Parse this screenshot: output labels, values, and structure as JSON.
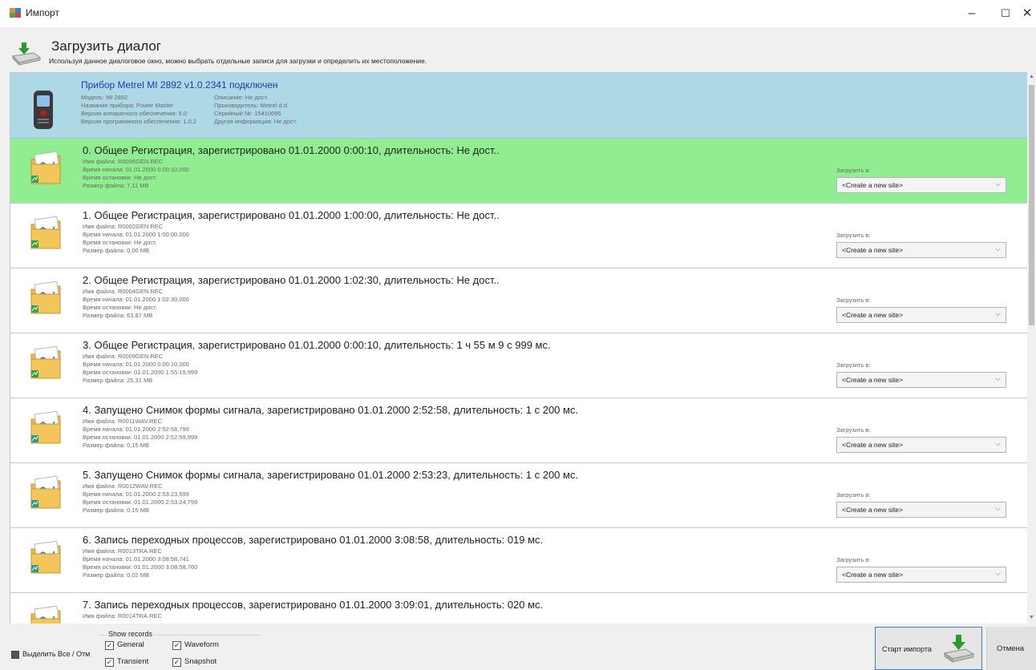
{
  "window": {
    "title": "Импорт",
    "minimize": "–",
    "maximize": "☐",
    "close": "✕"
  },
  "header": {
    "title": "Загрузить диалог",
    "description": "Используя данное диалоговое окно, можно выбрать отдельные записи для загрузки и определить их местоположение."
  },
  "device": {
    "title": "Прибор Metrel MI 2892 v1.0.2341 подключен",
    "model": "Модель: MI 2892",
    "name": "Название прибора: Power Master",
    "hw": "Версия аппаратного обеспечения: 5.0",
    "fw": "Версия программного обеспечения: 1.0.2",
    "desc": "Описание: Не дост.",
    "maker": "Производитель: Metrel d.d.",
    "serial": "Серийный №: 15410696",
    "other": "Другая информация: Не дост."
  },
  "colors": {
    "selected_row": "#90ee90",
    "device_row": "#add8e6",
    "link_blue": "#1a3ea8",
    "accent_border": "#3c7fd6"
  },
  "records": [
    {
      "title": "0. Общее Регистрация, зарегистрировано 01.01.2000 0:00:10, длительность: Не дост..",
      "file": "Имя файла: R0006GEN.REC",
      "start": "Время начала: 01.01.2000 0:00:10,000",
      "stop": "Время остановки: Не дост.",
      "size": "Размер файла: 7,11 MB",
      "load_label": "Загрузить в:",
      "site": "<Create a new site>",
      "icon": "log-folder-icon"
    },
    {
      "title": "1. Общее Регистрация, зарегистрировано 01.01.2000 1:00:00, длительность: Не дост..",
      "file": "Имя файла: R0002GEN.REC",
      "start": "Время начала: 01.01.2000 1:00:00,000",
      "stop": "Время остановки: Не дост.",
      "size": "Размер файла: 0,00 MB",
      "load_label": "Загрузить в:",
      "site": "<Create a new site>",
      "icon": "log-folder-icon"
    },
    {
      "title": "2. Общее Регистрация, зарегистрировано 01.01.2000 1:02:30, длительность: Не дост..",
      "file": "Имя файла: R0004GEN.REC",
      "start": "Время начала: 01.01.2000 1:02:30,000",
      "stop": "Время остановки: Не дост.",
      "size": "Размер файла: 63,87 MB",
      "load_label": "Загрузить в:",
      "site": "<Create a new site>",
      "icon": "log-folder-icon"
    },
    {
      "title": "3. Общее Регистрация, зарегистрировано 01.01.2000 0:00:10, длительность: 1 ч 55 м 9 с 999 мс.",
      "file": "Имя файла: R0009GEN.REC",
      "start": "Время начала: 01.01.2000 0:00:10,000",
      "stop": "Время остановки: 01.01.2000 1:55:19,999",
      "size": "Размер файла: 25,31 MB",
      "load_label": "Загрузить в:",
      "site": "<Create a new site>",
      "icon": "log-folder-icon"
    },
    {
      "title": "4. Запущено Снимок формы сигнала, зарегистрировано 01.01.2000 2:52:58, длительность: 1 с 200 мс.",
      "file": "Имя файла: R0011WAV.REC",
      "start": "Время начала: 01.01.2000 2:52:58,799",
      "stop": "Время остановки: 01.01.2000 2:52:59,999",
      "size": "Размер файла: 0,15 MB",
      "load_label": "Загрузить в:",
      "site": "<Create a new site>",
      "icon": "waveform-folder-icon"
    },
    {
      "title": "5. Запущено Снимок формы сигнала, зарегистрировано 01.01.2000 2:53:23, длительность: 1 с 200 мс.",
      "file": "Имя файла: R0012WAV.REC",
      "start": "Время начала: 01.01.2000 2:53:23,599",
      "stop": "Время остановки: 01.01.2000 2:53:24,799",
      "size": "Размер файла: 0,15 MB",
      "load_label": "Загрузить в:",
      "site": "<Create a new site>",
      "icon": "waveform-folder-icon"
    },
    {
      "title": "6. Запись переходных процессов, зарегистрировано 01.01.2000 3:08:58, длительность: 019 мс.",
      "file": "Имя файла: R0013TRA.REC",
      "start": "Время начала: 01.01.2000 3:08:58,741",
      "stop": "Время остановки: 01.01.2000 3:08:58,760",
      "size": "Размер файла: 0,02 MB",
      "load_label": "Загрузить в:",
      "site": "<Create a new site>",
      "icon": "transient-folder-icon"
    },
    {
      "title": "7. Запись переходных процессов, зарегистрировано 01.01.2000 3:09:01, длительность: 020 мс.",
      "file": "Имя файла: R0014TRA.REC",
      "start": "",
      "stop": "",
      "size": "",
      "load_label": "",
      "site": "",
      "icon": "transient-folder-icon"
    }
  ],
  "footer": {
    "select_all": "Выделить Все / Отм",
    "show_records": "Show records",
    "general": "General",
    "waveform": "Waveform",
    "transient": "Transient",
    "snapshot": "Snapshot",
    "check_mark": "✓",
    "start_import": "Старт импорта",
    "cancel": "Отмена"
  }
}
